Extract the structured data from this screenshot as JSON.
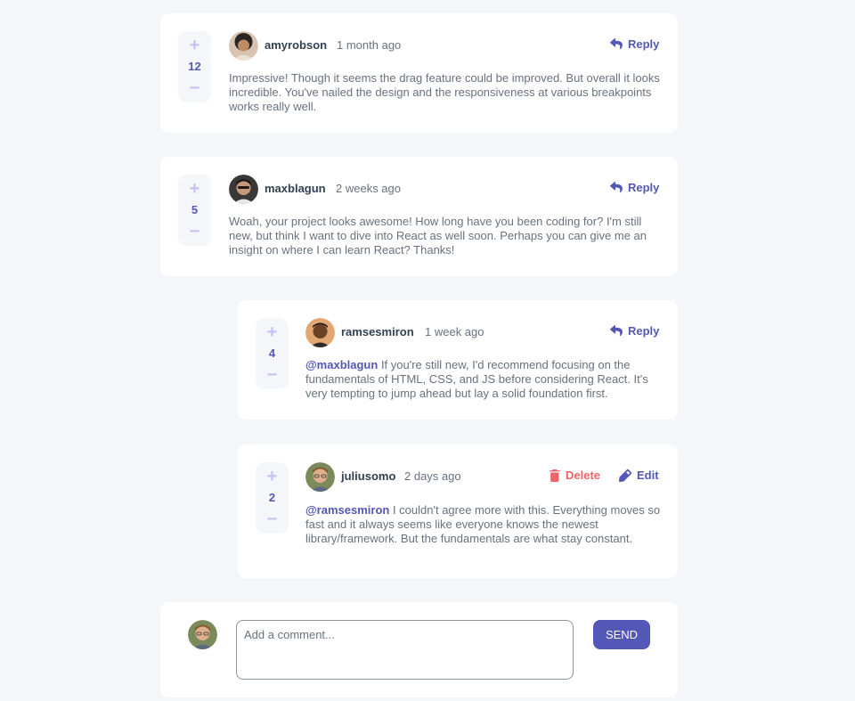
{
  "comments": [
    {
      "username": "amyrobson",
      "time": "1 month ago",
      "score": "12",
      "action": "Reply",
      "text": "Impressive! Though it seems the drag feature could be improved. But overall it looks incredible. You've nailed the design and the responsiveness at various breakpoints works really well."
    },
    {
      "username": "maxblagun",
      "time": "2 weeks ago",
      "score": "5",
      "action": "Reply",
      "text": "Woah, your project looks awesome! How long have you been coding for? I'm still new, but think I want to dive into React as well soon. Perhaps you can give me an insight on where I can learn React? Thanks!"
    }
  ],
  "replies": [
    {
      "username": "ramsesmiron",
      "time": "1 week ago",
      "score": "4",
      "action": "Reply",
      "mention": "@maxblagun",
      "text": "If you're still new, I'd recommend focusing on the fundamentals of HTML, CSS, and JS before considering React. It's very tempting to jump ahead but lay a solid foundation first."
    },
    {
      "username": "juliusomo",
      "time": "2 days ago",
      "score": "2",
      "delete_label": "Delete",
      "edit_label": "Edit",
      "mention": "@ramsesmiron",
      "text": "I couldn't agree more with this. Everything moves so fast and it always seems like everyone knows the newest library/framework. But the fundamentals are what stay constant."
    }
  ],
  "composer": {
    "placeholder": "Add a comment...",
    "send_label": "SEND"
  },
  "vote": {
    "plus": "+",
    "minus": "−"
  },
  "icons": {
    "reply": "reply-icon",
    "delete": "trash-icon",
    "edit": "pencil-icon"
  },
  "colors": {
    "accent": "#5357b6",
    "delete": "#ed6368",
    "background": "#f5f6fa",
    "text": "#67727e",
    "heading": "#324152",
    "vote_icon": "#c3c4ef"
  }
}
